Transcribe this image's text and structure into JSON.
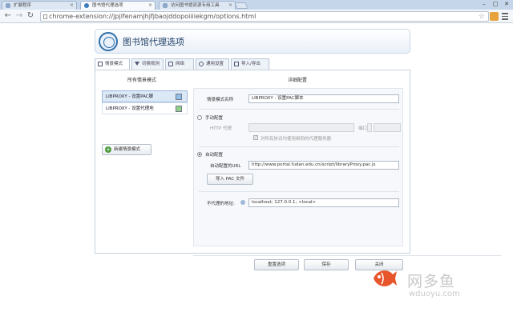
{
  "browser": {
    "tabs": [
      {
        "label": "扩展程序",
        "active": false
      },
      {
        "label": "图书馆代理选项",
        "active": true
      },
      {
        "label": "访问图书馆资源专用工具",
        "active": false
      }
    ],
    "url": "chrome-extension://jpjlfenamjhjfjbaojddopoiiiiekgm/options.html",
    "win_controls": [
      "–",
      "□",
      "✕"
    ]
  },
  "header": {
    "title": "图书馆代理选项"
  },
  "options_tabs": [
    {
      "label": "情景模式",
      "icon": "list-icon",
      "active": true
    },
    {
      "label": "切换规则",
      "icon": "filter-icon",
      "active": false
    },
    {
      "label": "网络",
      "icon": "network-icon",
      "active": false
    },
    {
      "label": "通用设置",
      "icon": "gear-icon",
      "active": false
    },
    {
      "label": "导入/导出",
      "icon": "import-export-icon",
      "active": false
    }
  ],
  "profiles": {
    "heading": "所有情景模式",
    "items": [
      {
        "label": "LIBPROXY - 设置PAC脚",
        "color": "#8fc0e8",
        "selected": true
      },
      {
        "label": "LIBPROXY - 设置代理地",
        "color": "#8fd08a",
        "selected": false
      }
    ],
    "new_button": "新建情景模式"
  },
  "detail": {
    "heading": "详细配置",
    "name_label": "情景模式名称",
    "name_value": "LIBPROXY - 设置PAC脚本",
    "manual_label": "手动配置",
    "http_label": "HTTP 代理",
    "http_value": "",
    "port_label": "端口",
    "port_value": "",
    "same_proxy_label": "对所有协议均使用相同的代理服务器",
    "auto_label": "自动配置",
    "auto_url_label": "自动配置的URL",
    "auto_url_value": "http://www.portal.fudan.edu.cn/script/libraryProxy.pac.js",
    "import_pac_button": "导入 PAC 文件",
    "bypass_label": "不代理的地址:",
    "bypass_value": "localhost; 127.0.0.1; <local>"
  },
  "footer": {
    "reset_button": "重置选项",
    "save_button": "保存",
    "close_button": "关闭"
  },
  "watermark": {
    "text": "网多鱼",
    "url": "wduoyu.com",
    "color": "#e8552b"
  }
}
